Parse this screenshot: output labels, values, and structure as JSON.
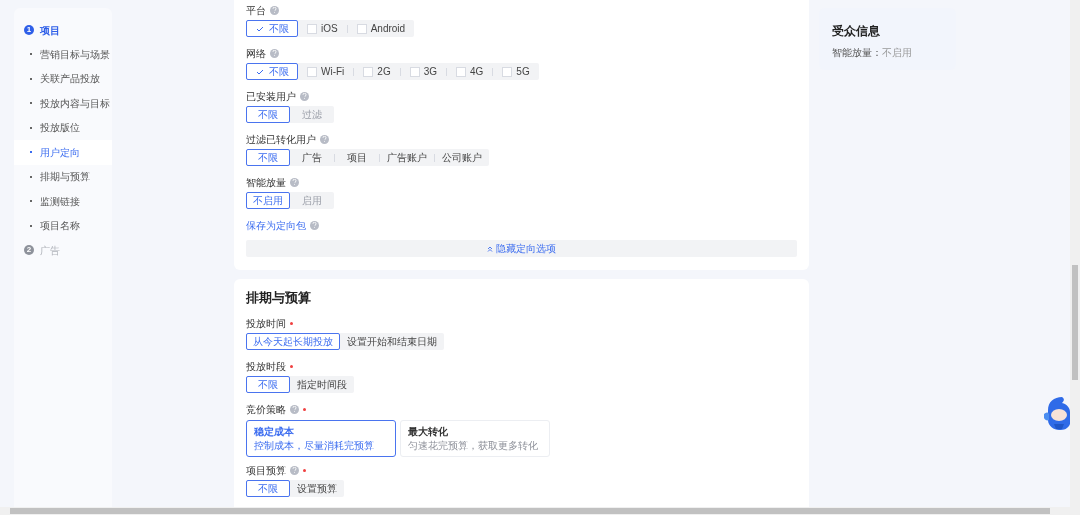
{
  "sidebar": {
    "steps": [
      {
        "number": "1",
        "label": "项目",
        "active": true,
        "children": [
          {
            "label": "营销目标与场景",
            "selected": false
          },
          {
            "label": "关联产品投放",
            "selected": false
          },
          {
            "label": "投放内容与目标",
            "selected": false
          },
          {
            "label": "投放版位",
            "selected": false
          },
          {
            "label": "用户定向",
            "selected": true
          },
          {
            "label": "排期与预算",
            "selected": false
          },
          {
            "label": "监测链接",
            "selected": false
          },
          {
            "label": "项目名称",
            "selected": false
          }
        ]
      },
      {
        "number": "2",
        "label": "广告",
        "active": false
      }
    ]
  },
  "targeting": {
    "fields": [
      {
        "label": "平台",
        "help": true,
        "required": false,
        "kind": "checkbox",
        "options": [
          {
            "label": "不限",
            "selected": true,
            "disabled": false
          },
          {
            "label": "iOS",
            "selected": false,
            "disabled": false
          },
          {
            "label": "Android",
            "selected": false,
            "disabled": false
          }
        ]
      },
      {
        "label": "网络",
        "help": true,
        "required": false,
        "kind": "checkbox",
        "options": [
          {
            "label": "不限",
            "selected": true,
            "disabled": false
          },
          {
            "label": "Wi-Fi",
            "selected": false,
            "disabled": false
          },
          {
            "label": "2G",
            "selected": false,
            "disabled": false
          },
          {
            "label": "3G",
            "selected": false,
            "disabled": false
          },
          {
            "label": "4G",
            "selected": false,
            "disabled": false
          },
          {
            "label": "5G",
            "selected": false,
            "disabled": false
          }
        ]
      },
      {
        "label": "已安装用户",
        "help": true,
        "required": false,
        "kind": "segment",
        "options": [
          {
            "label": "不限",
            "selected": true,
            "disabled": false
          },
          {
            "label": "过滤",
            "selected": false,
            "disabled": true
          }
        ]
      },
      {
        "label": "过滤已转化用户",
        "help": true,
        "required": false,
        "kind": "segment",
        "options": [
          {
            "label": "不限",
            "selected": true,
            "disabled": false
          },
          {
            "label": "广告",
            "selected": false,
            "disabled": false
          },
          {
            "label": "项目",
            "selected": false,
            "disabled": false
          },
          {
            "label": "广告账户",
            "selected": false,
            "disabled": false
          },
          {
            "label": "公司账户",
            "selected": false,
            "disabled": false
          }
        ]
      },
      {
        "label": "智能放量",
        "help": true,
        "required": false,
        "kind": "segment",
        "options": [
          {
            "label": "不启用",
            "selected": true,
            "disabled": false
          },
          {
            "label": "启用",
            "selected": false,
            "disabled": true
          }
        ]
      }
    ],
    "save_link": {
      "label": "保存为定向包",
      "help": true
    },
    "toggle_button": {
      "label": "隐藏定向选项"
    }
  },
  "schedule": {
    "title": "排期与预算",
    "fields": [
      {
        "label": "投放时间",
        "help": false,
        "required": true,
        "kind": "segment",
        "options": [
          {
            "label": "从今天起长期投放",
            "selected": true,
            "disabled": false
          },
          {
            "label": "设置开始和结束日期",
            "selected": false,
            "disabled": false
          }
        ]
      },
      {
        "label": "投放时段",
        "help": false,
        "required": true,
        "kind": "segment",
        "options": [
          {
            "label": "不限",
            "selected": true,
            "disabled": false
          },
          {
            "label": "指定时间段",
            "selected": false,
            "disabled": false
          }
        ]
      },
      {
        "label": "竞价策略",
        "help": true,
        "required": true,
        "kind": "card",
        "options": [
          {
            "label": "稳定成本",
            "description": "控制成本，尽量消耗完预算",
            "selected": true,
            "disabled": false
          },
          {
            "label": "最大转化",
            "description": "匀速花完预算，获取更多转化",
            "selected": false,
            "disabled": false
          }
        ]
      },
      {
        "label": "项目预算",
        "help": true,
        "required": true,
        "kind": "segment",
        "options": [
          {
            "label": "不限",
            "selected": true,
            "disabled": false
          },
          {
            "label": "设置预算",
            "selected": false,
            "disabled": false
          }
        ]
      }
    ]
  },
  "audience_panel": {
    "title": "受众信息",
    "items": [
      {
        "label": "智能放量：",
        "value": "不启用"
      }
    ]
  }
}
